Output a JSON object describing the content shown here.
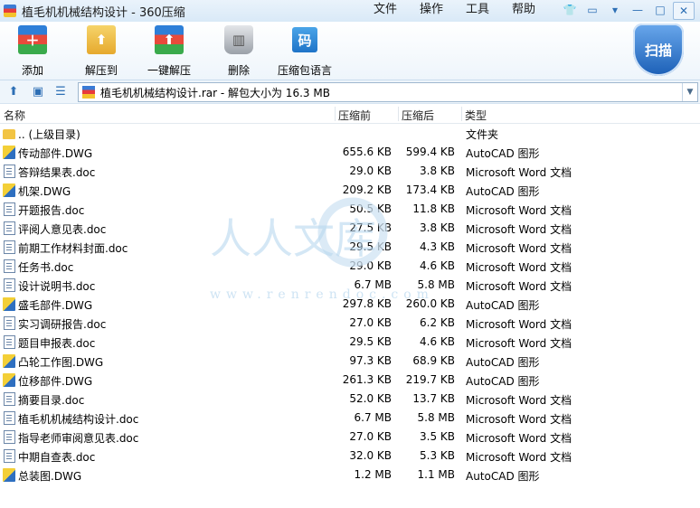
{
  "window": {
    "title": "植毛机机械结构设计 - 360压缩"
  },
  "menu": [
    "文件",
    "操作",
    "工具",
    "帮助"
  ],
  "toolbar": {
    "items": [
      {
        "label": "添加",
        "icon": "add-icon"
      },
      {
        "label": "解压到",
        "icon": "extract-to-icon"
      },
      {
        "label": "一键解压",
        "icon": "one-click-extract-icon"
      },
      {
        "label": "删除",
        "icon": "delete-icon"
      },
      {
        "label": "压缩包语言",
        "icon": "archive-language-icon",
        "glyph": "码"
      }
    ],
    "scan_label": "扫描"
  },
  "address": {
    "path": "植毛机机械结构设计.rar - 解包大小为 16.3 MB"
  },
  "columns": {
    "name": "名称",
    "compressed_before": "压缩前",
    "compressed_after": "压缩后",
    "type": "类型"
  },
  "files": [
    {
      "name": ".. (上级目录)",
      "before": "",
      "after": "",
      "type": "文件夹",
      "kind": "up"
    },
    {
      "name": "传动部件.DWG",
      "before": "655.6 KB",
      "after": "599.4 KB",
      "type": "AutoCAD 图形",
      "kind": "dwg"
    },
    {
      "name": "答辩结果表.doc",
      "before": "29.0 KB",
      "after": "3.8 KB",
      "type": "Microsoft Word 文档",
      "kind": "doc"
    },
    {
      "name": "机架.DWG",
      "before": "209.2 KB",
      "after": "173.4 KB",
      "type": "AutoCAD 图形",
      "kind": "dwg"
    },
    {
      "name": "开题报告.doc",
      "before": "50.5 KB",
      "after": "11.8 KB",
      "type": "Microsoft Word 文档",
      "kind": "doc"
    },
    {
      "name": "评阅人意见表.doc",
      "before": "27.5 KB",
      "after": "3.8 KB",
      "type": "Microsoft Word 文档",
      "kind": "doc"
    },
    {
      "name": "前期工作材料封面.doc",
      "before": "29.5 KB",
      "after": "4.3 KB",
      "type": "Microsoft Word 文档",
      "kind": "doc"
    },
    {
      "name": "任务书.doc",
      "before": "29.0 KB",
      "after": "4.6 KB",
      "type": "Microsoft Word 文档",
      "kind": "doc"
    },
    {
      "name": "设计说明书.doc",
      "before": "6.7 MB",
      "after": "5.8 MB",
      "type": "Microsoft Word 文档",
      "kind": "doc"
    },
    {
      "name": "盛毛部件.DWG",
      "before": "297.8 KB",
      "after": "260.0 KB",
      "type": "AutoCAD 图形",
      "kind": "dwg"
    },
    {
      "name": "实习调研报告.doc",
      "before": "27.0 KB",
      "after": "6.2 KB",
      "type": "Microsoft Word 文档",
      "kind": "doc"
    },
    {
      "name": "题目申报表.doc",
      "before": "29.5 KB",
      "after": "4.6 KB",
      "type": "Microsoft Word 文档",
      "kind": "doc"
    },
    {
      "name": "凸轮工作图.DWG",
      "before": "97.3 KB",
      "after": "68.9 KB",
      "type": "AutoCAD 图形",
      "kind": "dwg"
    },
    {
      "name": "位移部件.DWG",
      "before": "261.3 KB",
      "after": "219.7 KB",
      "type": "AutoCAD 图形",
      "kind": "dwg"
    },
    {
      "name": "摘要目录.doc",
      "before": "52.0 KB",
      "after": "13.7 KB",
      "type": "Microsoft Word 文档",
      "kind": "doc"
    },
    {
      "name": "植毛机机械结构设计.doc",
      "before": "6.7 MB",
      "after": "5.8 MB",
      "type": "Microsoft Word 文档",
      "kind": "doc"
    },
    {
      "name": "指导老师审阅意见表.doc",
      "before": "27.0 KB",
      "after": "3.5 KB",
      "type": "Microsoft Word 文档",
      "kind": "doc"
    },
    {
      "name": "中期自查表.doc",
      "before": "32.0 KB",
      "after": "5.3 KB",
      "type": "Microsoft Word 文档",
      "kind": "doc"
    },
    {
      "name": "总装图.DWG",
      "before": "1.2 MB",
      "after": "1.1 MB",
      "type": "AutoCAD 图形",
      "kind": "dwg"
    }
  ],
  "watermark": {
    "text": "人人文库",
    "url": "www.renrendoc.com"
  },
  "colors": {
    "accent": "#2d6fb5",
    "titlebar": "#d9e9f7"
  }
}
